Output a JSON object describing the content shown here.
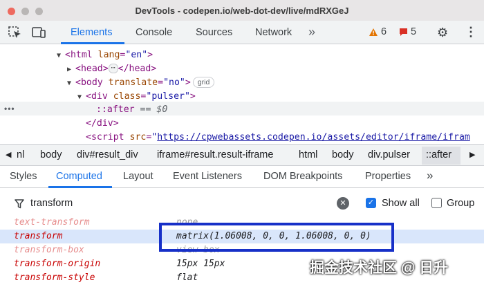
{
  "window": {
    "title": "DevTools - codepen.io/web-dot-dev/live/mdRXGeJ"
  },
  "toolbar": {
    "tabs": [
      "Elements",
      "Console",
      "Sources",
      "Network"
    ],
    "more": "»",
    "warnings": "6",
    "errors": "5"
  },
  "dom": {
    "html_tag": "<html",
    "html_attr": "lang",
    "html_val": "\"en\"",
    "head_open": "<head>",
    "head_close": "</head>",
    "head_dots": "⋯",
    "body_tag": "<body",
    "body_attr": "translate",
    "body_val": "\"no\"",
    "body_pill": "grid",
    "div_tag": "<div",
    "div_attr": "class",
    "div_val": "\"pulser\"",
    "after_pseudo": "::after",
    "after_eq": "==",
    "after_dollar": "$0",
    "div_close": "</div>",
    "script_tag": "<script",
    "script_attr": "src",
    "script_val": "https://cpwebassets.codepen.io/assets/editor/iframe/ifram",
    "gutter_dots": "•••"
  },
  "breadcrumbs": [
    "nl",
    "body",
    "div#result_div",
    "iframe#result.result-iframe",
    "html",
    "body",
    "div.pulser",
    "::after"
  ],
  "subtabs": [
    "Styles",
    "Computed",
    "Layout",
    "Event Listeners",
    "DOM Breakpoints",
    "Properties"
  ],
  "subtabs_more": "»",
  "filter": {
    "value": "transform",
    "show_all_label": "Show all",
    "group_label": "Group"
  },
  "computed": [
    {
      "name": "text-transform",
      "value": "none"
    },
    {
      "name": "transform",
      "value": "matrix(1.06008, 0, 0, 1.06008, 0, 0)"
    },
    {
      "name": "transform-box",
      "value": "view-box"
    },
    {
      "name": "transform-origin",
      "value": "15px 15px"
    },
    {
      "name": "transform-style",
      "value": "flat"
    }
  ],
  "watermark": "掘金技术社区 @ 日升"
}
